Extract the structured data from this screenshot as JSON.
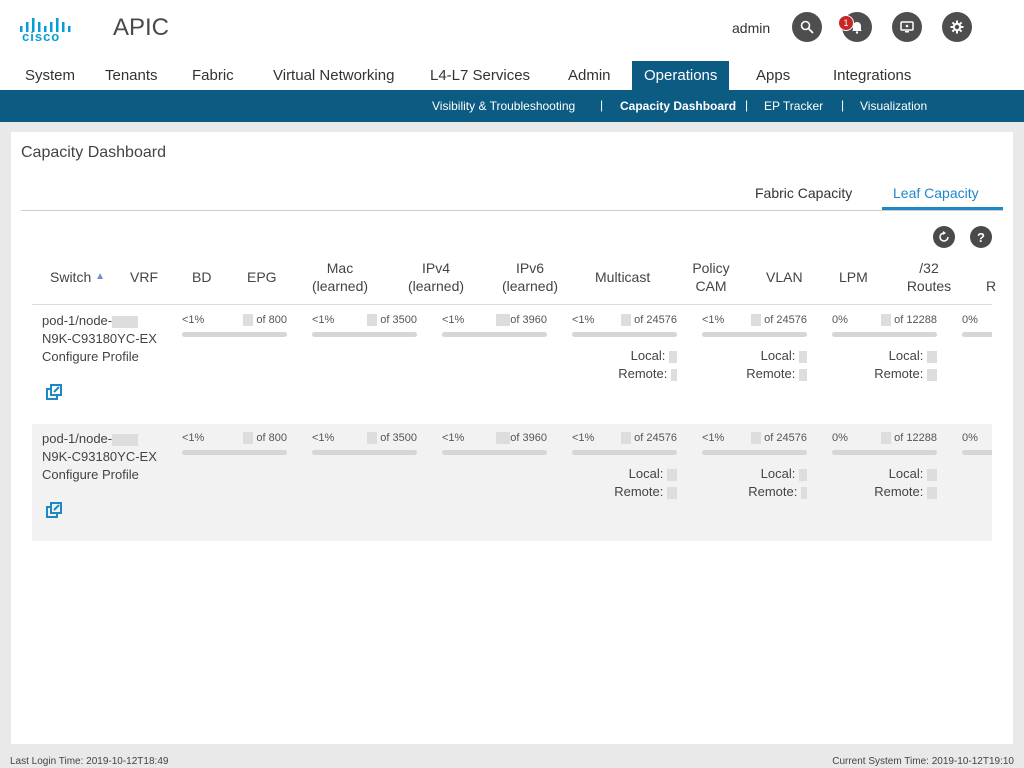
{
  "header": {
    "logo_text": "cisco",
    "app_name": "APIC",
    "user": "admin",
    "notification_count": "1",
    "icons": [
      "search-icon",
      "bell-icon",
      "monitor-icon",
      "gear-icon"
    ]
  },
  "tabs": [
    "System",
    "Tenants",
    "Fabric",
    "Virtual Networking",
    "L4-L7 Services",
    "Admin",
    "Operations",
    "Apps",
    "Integrations"
  ],
  "active_tab": "Operations",
  "subnav": [
    "Visibility & Troubleshooting",
    "Capacity Dashboard",
    "EP Tracker",
    "Visualization"
  ],
  "active_subnav": "Capacity Dashboard",
  "panel": {
    "title": "Capacity Dashboard",
    "tabs": [
      "Fabric Capacity",
      "Leaf Capacity"
    ],
    "active_tab": "Leaf Capacity",
    "refresh_icon": "refresh-icon",
    "help_label": "?"
  },
  "columns": [
    "Switch",
    "VRF",
    "BD",
    "EPG",
    "Mac (learned)",
    "IPv4 (learned)",
    "IPv6 (learned)",
    "Multicast",
    "Policy CAM",
    "VLAN",
    "LPM",
    "/32 Routes",
    "R"
  ],
  "rows": [
    {
      "switch": "pod-1/node-",
      "model": "N9K-C93180YC-EX",
      "configure": "Configure Profile",
      "cells": {
        "bd": {
          "pct": "<1%",
          "of": "of 800"
        },
        "mac": {
          "pct": "<1%",
          "of": "of 3500"
        },
        "ipv4": {
          "pct": "<1%",
          "of": "of 3960"
        },
        "multicast": {
          "pct": "<1%",
          "of": "of 24576",
          "local": "Local:",
          "remote": "Remote:"
        },
        "policy_cam": {
          "pct": "<1%",
          "of": "of 24576",
          "local": "Local:",
          "remote": "Remote:"
        },
        "lpm": {
          "pct": "0%",
          "of": "of 12288",
          "local": "Local:",
          "remote": "Remote:"
        },
        "routes": {
          "pct": "0%"
        }
      }
    },
    {
      "switch": "pod-1/node-",
      "model": "N9K-C93180YC-EX",
      "configure": "Configure Profile",
      "cells": {
        "bd": {
          "pct": "<1%",
          "of": "of 800"
        },
        "mac": {
          "pct": "<1%",
          "of": "of 3500"
        },
        "ipv4": {
          "pct": "<1%",
          "of": "of 3960"
        },
        "multicast": {
          "pct": "<1%",
          "of": "of 24576",
          "local": "Local:",
          "remote": "Remote:"
        },
        "policy_cam": {
          "pct": "<1%",
          "of": "of 24576",
          "local": "Local:",
          "remote": "Remote:"
        },
        "lpm": {
          "pct": "0%",
          "of": "of 12288",
          "local": "Local:",
          "remote": "Remote:"
        },
        "routes": {
          "pct": "0%"
        }
      }
    }
  ],
  "footer": {
    "last_login": "Last Login Time: 2019-10-12T18:49",
    "current_time": "Current System Time: 2019-10-12T19:10"
  }
}
